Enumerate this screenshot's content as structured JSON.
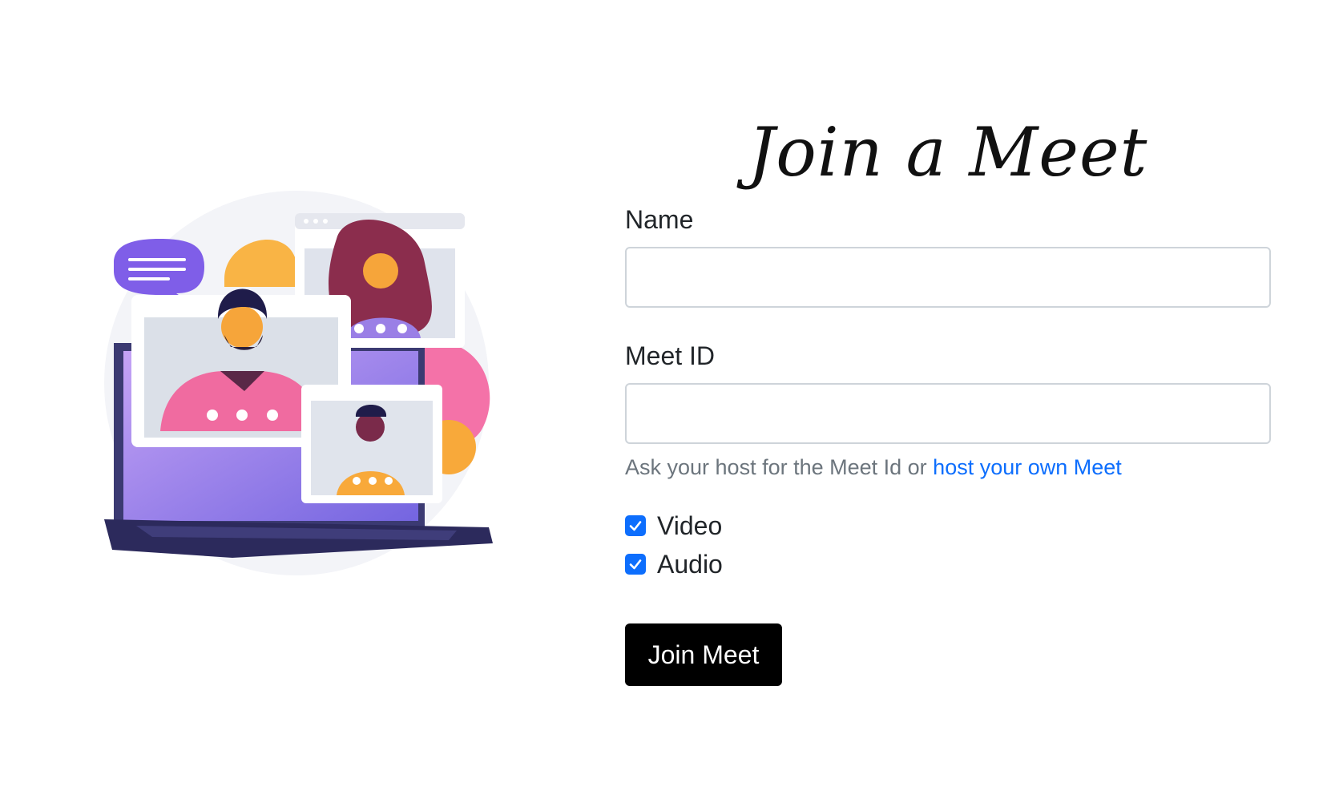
{
  "title": "Join a Meet",
  "form": {
    "name_label": "Name",
    "name_value": "",
    "meet_id_label": "Meet ID",
    "meet_id_value": "",
    "help_text": "Ask your host for the Meet Id or ",
    "help_link": "host your own Meet",
    "video_label": "Video",
    "video_checked": true,
    "audio_label": "Audio",
    "audio_checked": true,
    "join_button": "Join Meet"
  },
  "colors": {
    "accent": "#0d6efd",
    "button_bg": "#000000",
    "help_text": "#6c757d"
  },
  "illustration": {
    "icon": "video-conference-illustration"
  }
}
